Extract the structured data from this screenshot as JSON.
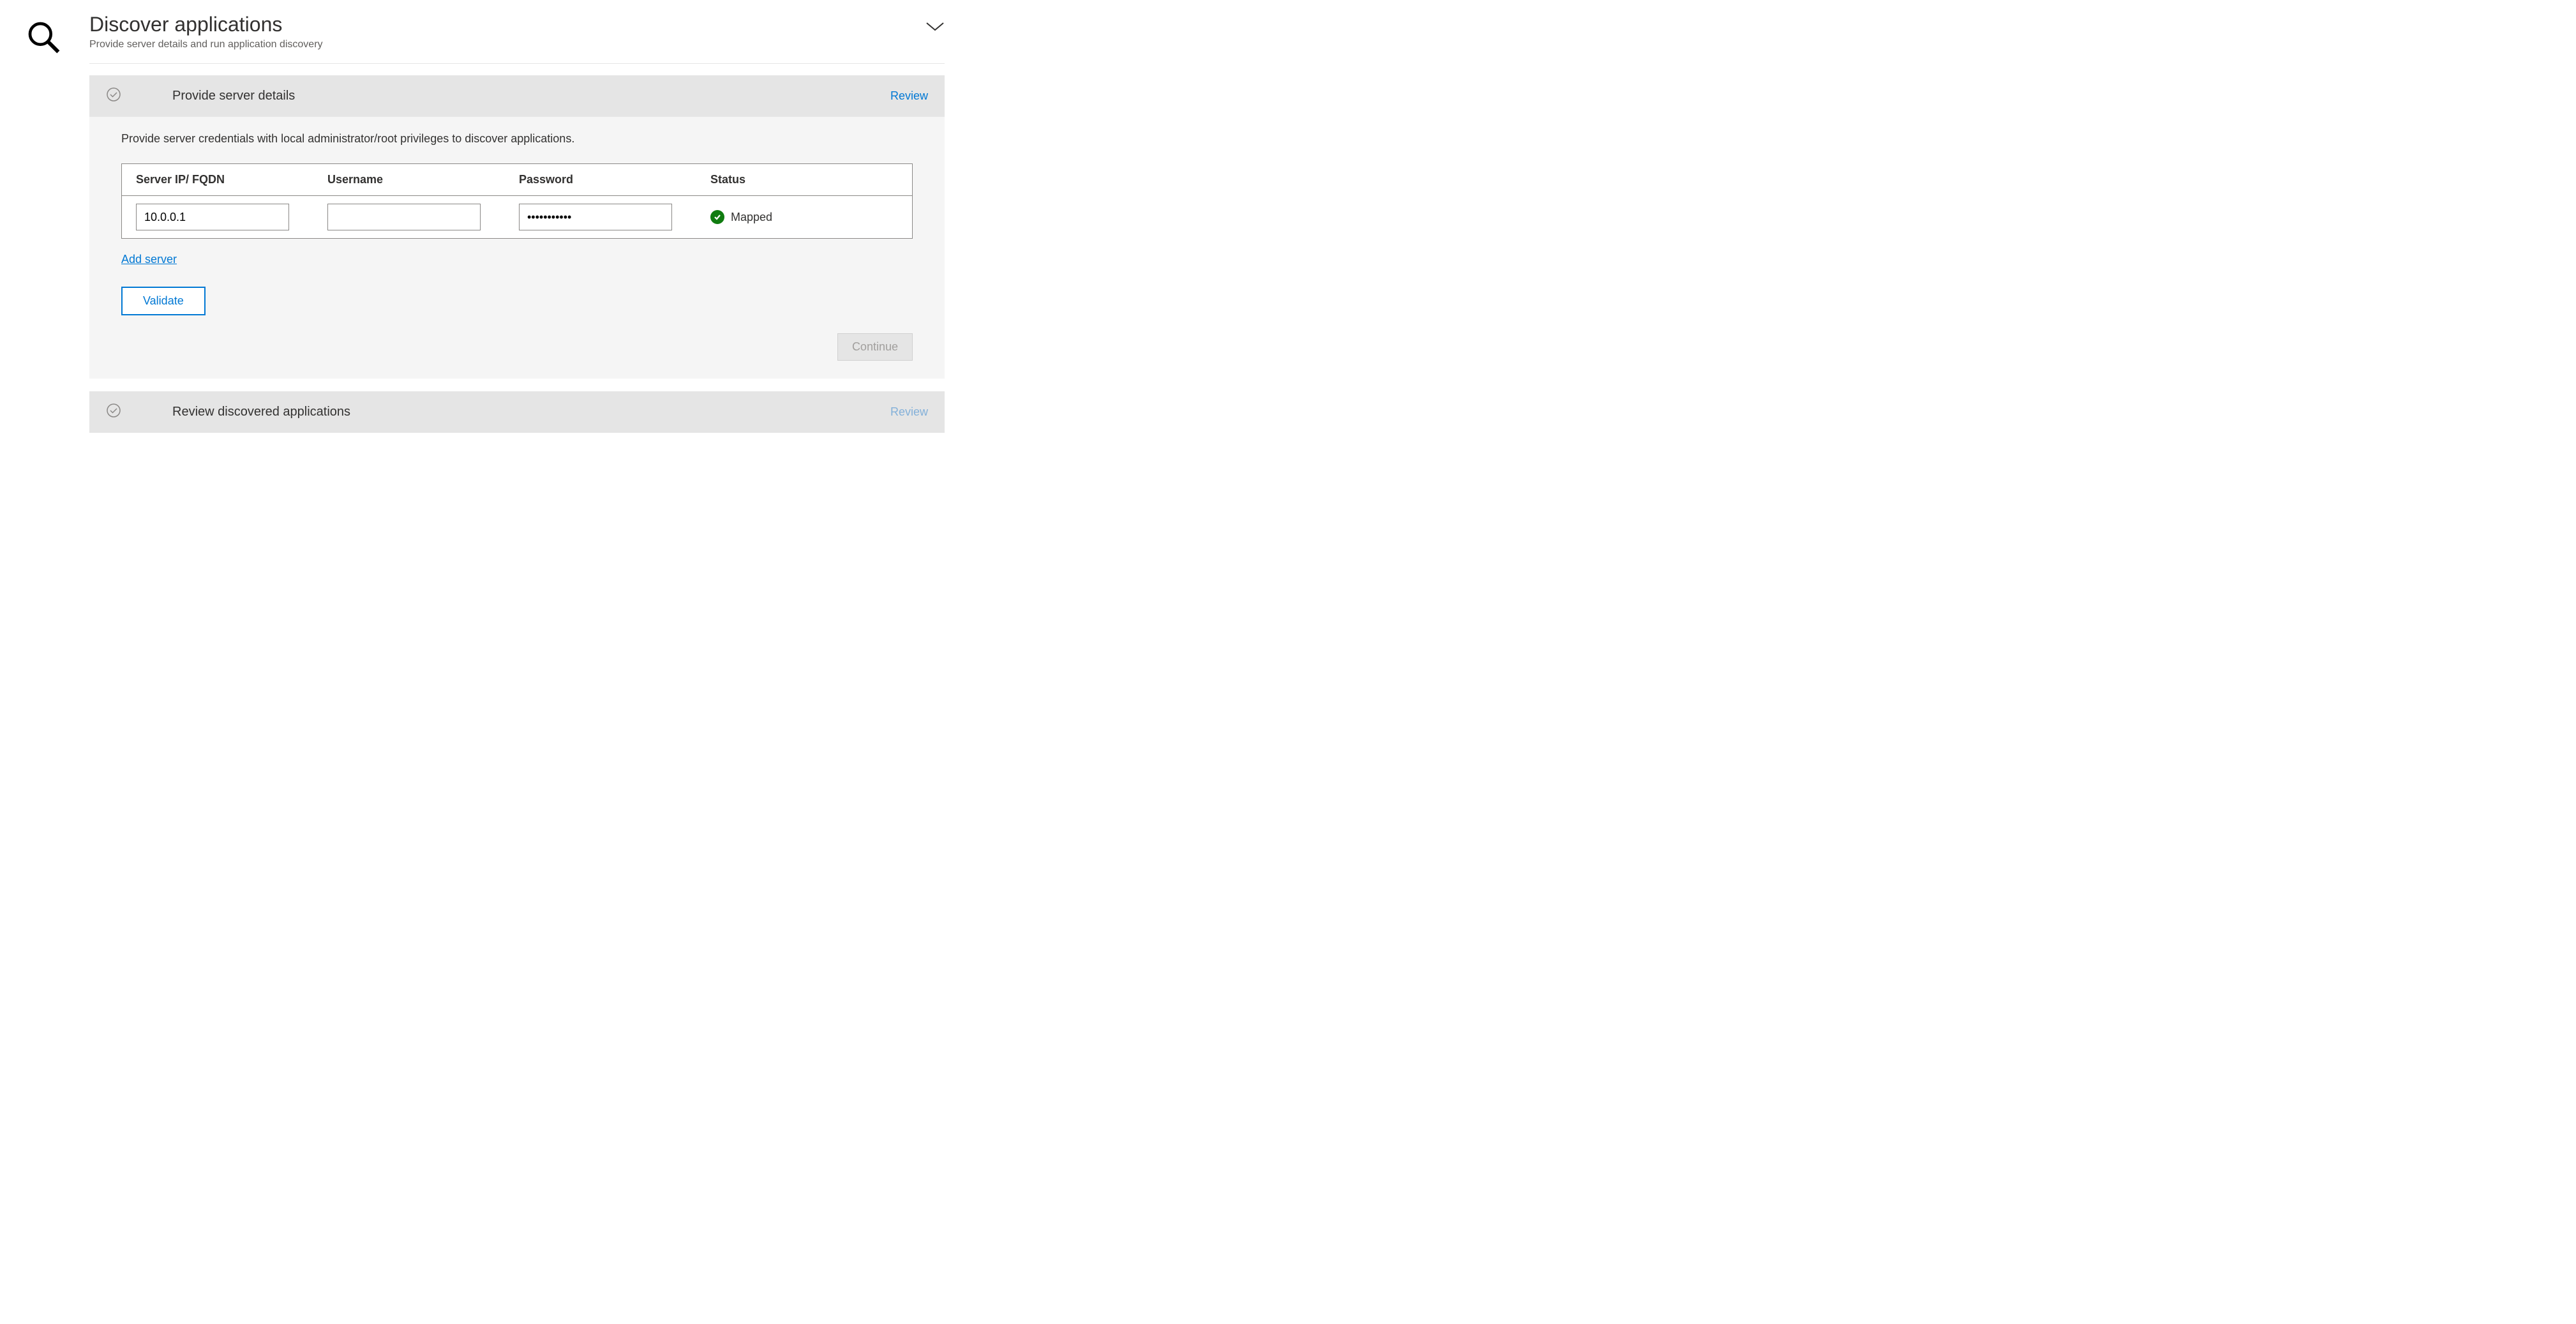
{
  "header": {
    "title": "Discover applications",
    "subtitle": "Provide server details and run application discovery"
  },
  "step1": {
    "title": "Provide server details",
    "review_label": "Review",
    "instruction": "Provide server credentials with local administrator/root privileges to discover applications.",
    "columns": {
      "ip": "Server IP/ FQDN",
      "username": "Username",
      "password": "Password",
      "status": "Status"
    },
    "row": {
      "ip": "10.0.0.1",
      "username": "",
      "password": "•••••••••••",
      "status_label": "Mapped"
    },
    "add_server_label": "Add server",
    "validate_label": "Validate",
    "continue_label": "Continue"
  },
  "step2": {
    "title": "Review discovered applications",
    "review_label": "Review"
  }
}
